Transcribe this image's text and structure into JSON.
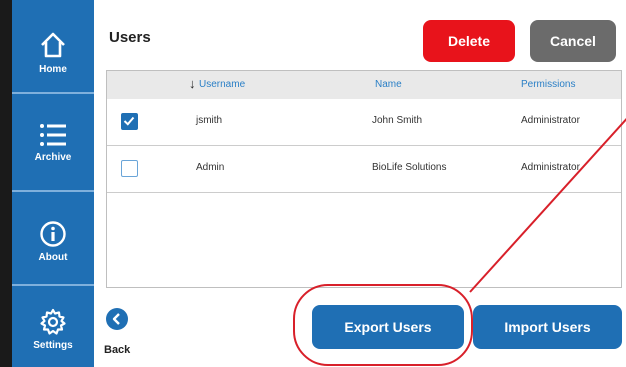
{
  "sidebar": {
    "items": [
      {
        "label": "Home",
        "icon": "home-icon"
      },
      {
        "label": "Archive",
        "icon": "list-icon"
      },
      {
        "label": "About",
        "icon": "info-icon"
      },
      {
        "label": "Settings",
        "icon": "gear-icon"
      }
    ]
  },
  "header": {
    "title": "Users",
    "delete_label": "Delete",
    "cancel_label": "Cancel"
  },
  "table": {
    "columns": [
      "Username",
      "Name",
      "Permissions"
    ],
    "sort_column": "Username",
    "rows": [
      {
        "checked": true,
        "username": "jsmith",
        "name": "John Smith",
        "permissions": "Administrator"
      },
      {
        "checked": false,
        "username": "Admin",
        "name": "BioLife Solutions",
        "permissions": "Administrator"
      }
    ]
  },
  "footer": {
    "back_label": "Back",
    "export_label": "Export Users",
    "import_label": "Import Users"
  },
  "colors": {
    "primary": "#1f6fb4",
    "danger": "#e8131b",
    "neutral": "#6b6b6b",
    "annotation": "#d8202a"
  }
}
